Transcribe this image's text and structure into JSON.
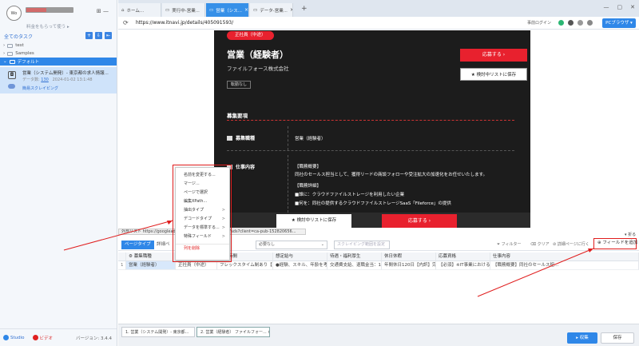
{
  "sidebar": {
    "logo_text": "Wo",
    "account_sub": "料金をもらって使う ▸",
    "window_icons": "⊞ —",
    "all_tasks": "全てのタスク",
    "tree": [
      {
        "label": "test"
      },
      {
        "label": "Samples"
      },
      {
        "label": "デフォルト"
      }
    ],
    "task": {
      "title": "営業（システム開発）- 東京都の求人情報...",
      "data_label": "データ数:",
      "data_count": "130",
      "date": "2024-01-02 13:1:48",
      "scraping_link": "簡易スクレイピング"
    },
    "footer": {
      "studio": "Studio",
      "video": "ビデオ",
      "version": "バージョン: 3.4.4"
    }
  },
  "browser": {
    "tabs": [
      {
        "label": "ホーム..."
      },
      {
        "label": "実行中-営業..."
      },
      {
        "label": "営業（シス..."
      },
      {
        "label": "データ-営業..."
      }
    ],
    "new_tab": "+",
    "url": "https://www.itnavi.jp/details/405091593/",
    "login": "事前ログイン",
    "pc_browser": "PCブラウザ ▾"
  },
  "job": {
    "pill": "正社員（中途）",
    "title": "営業（経験者）",
    "company": "ファイルフォース株式会社",
    "tag": "転勤なし",
    "apply": "応募する",
    "save": "検討中リストに保存",
    "section": "募集要項",
    "rows": [
      {
        "label": "募集職種",
        "value": "営業（経験者）"
      },
      {
        "label": "仕事内容",
        "value": "【職務概要】"
      }
    ],
    "detail": [
      "同社のセールス担当として、獲得リードの商談フォローや受注拡大の加速化をお任せいたします。",
      "【職務詳細】",
      "■誰に：クラウドファイルストレージを利用したい企業",
      "■何を：同社の提供するクラウドファイルストレージSaaS「Fileforce」の提供"
    ],
    "bottom_save": "検討中リストに保存",
    "bottom_apply": "応募する"
  },
  "url_strip": "外部リスト https://googleads.g.doubleclick.net/pagead/ads?client=ca-pub-152820656...",
  "mark_label": "▾ 折る",
  "context_menu": {
    "items": [
      {
        "label": "名前を変更する..."
      },
      {
        "label": "マージ..."
      },
      {
        "label": "ページで選択"
      },
      {
        "label": "編集XPath..."
      },
      {
        "label": "抽出タイプ",
        "arrow": ">"
      },
      {
        "label": "デコードタイプ",
        "arrow": ">"
      },
      {
        "label": "データを標準する...",
        "arrow": ">"
      },
      {
        "label": "特殊フィールド",
        "arrow": ">"
      },
      {
        "label": "列を削除"
      }
    ]
  },
  "data_toolbar": {
    "tab_active": "ページタイプ",
    "tab2": "詳細ペ",
    "select": "必要なし",
    "scraping_range": "スクレイピング範囲を設定",
    "filter": "フィルター",
    "clear": "クリア",
    "detail_link": "詳細ページに行く",
    "add_field": "フィールドを追加"
  },
  "table": {
    "headers": [
      "",
      "募集職種",
      "",
      "勤務時間",
      "想定給与",
      "待遇・福利厚生",
      "休日休暇",
      "応募資格",
      "仕事内容"
    ],
    "row": [
      "1",
      "営業（経験者）",
      "正社員（中途）",
      "フレックスタイム制あり【コア...",
      "●経験、スキル、年齢を考慮の...",
      "交通費支給、退職金当：1000...",
      "年間休日120日【内訳】完全週...",
      "【必須】※IT事業における法...",
      "【職務概要】同社のセールス担..."
    ]
  },
  "bottom_bar": {
    "tab1": "1. 営業（システム開発）- 東京都...",
    "tab2": "2. 営業（経験者） ファイルフォー...",
    "collect": "▸ 収集",
    "save": "保存"
  },
  "colors": {
    "accent": "#2f87e8",
    "red": "#e8212e",
    "annotation": "#e01d1d"
  }
}
